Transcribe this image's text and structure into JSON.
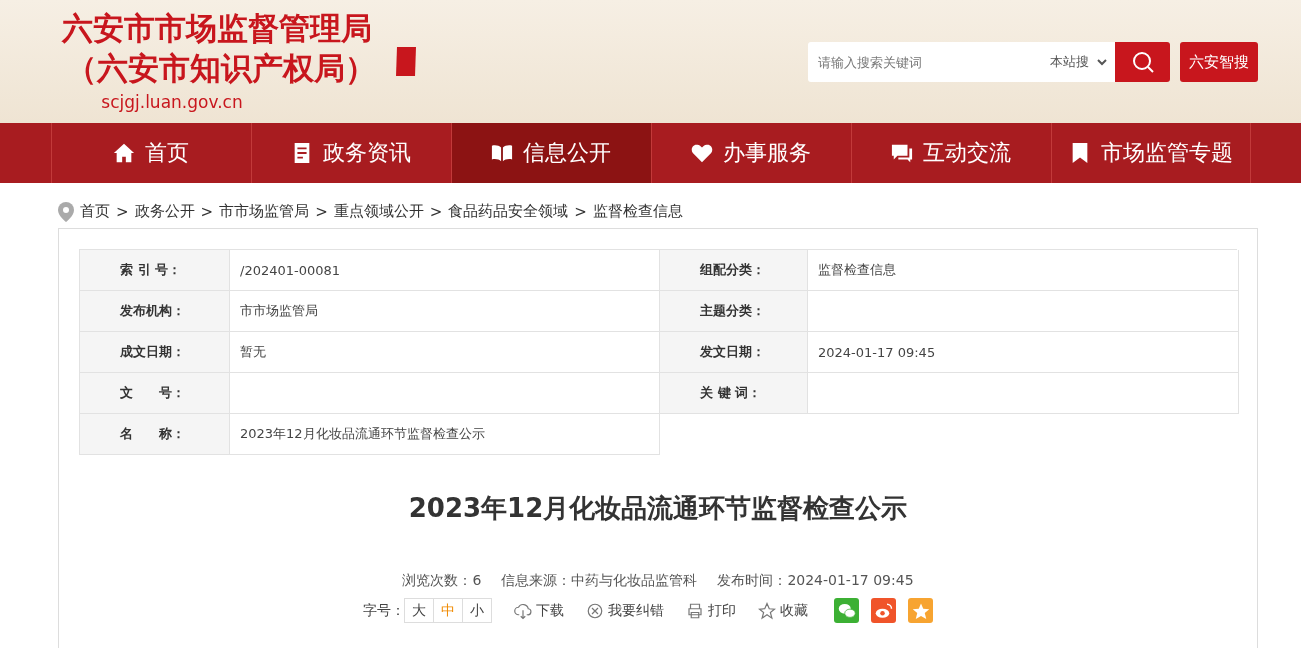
{
  "header": {
    "title_line_1": "六安市市场监督管理局",
    "title_line_2": "（六安市知识产权局）",
    "domain": "scjgj.luan.gov.cn"
  },
  "search": {
    "placeholder": "请输入搜索关键词",
    "scope": "本站搜",
    "smart_search": "六安智搜"
  },
  "nav": [
    {
      "label": "首页",
      "selected": false
    },
    {
      "label": "政务资讯",
      "selected": false
    },
    {
      "label": "信息公开",
      "selected": true
    },
    {
      "label": "办事服务",
      "selected": false
    },
    {
      "label": "互动交流",
      "selected": false
    },
    {
      "label": "市场监管专题",
      "selected": false
    }
  ],
  "breadcrumb": [
    {
      "label": "首页"
    },
    {
      "separator": ">",
      "label": "政务公开"
    },
    {
      "separator": ">",
      "label": "市市场监管局"
    },
    {
      "separator": ">",
      "label": "重点领域公开"
    },
    {
      "separator": ">",
      "label": "食品药品安全领域"
    },
    {
      "separator": ">",
      "label": "监督检查信息"
    }
  ],
  "info_table": [
    [
      {
        "label": "索 引 号：",
        "value": "/202401-00081"
      },
      {
        "label": "组配分类：",
        "value": "监督检查信息"
      }
    ],
    [
      {
        "label": "发布机构：",
        "value": "市市场监管局"
      },
      {
        "label": "主题分类："
      }
    ],
    [
      {
        "label": "成文日期：",
        "value": "暂无"
      },
      {
        "label": "发文日期：",
        "value": "2024-01-17 09:45"
      }
    ],
    [
      {
        "label": "文　　号："
      },
      {
        "label": "关 键 词："
      }
    ],
    [
      {
        "label": "名　　称：",
        "value": "2023年12月化妆品流通环节监督检查公示"
      }
    ]
  ],
  "article": {
    "title": "2023年12月化妆品流通环节监督检查公示",
    "meta": [
      "浏览次数：6",
      "信息来源：中药与化妆品监管科",
      "发布时间：2024-01-17 09:45"
    ],
    "font_size_label": "字号：",
    "font_sizes": [
      {
        "label": "大",
        "selected": false
      },
      {
        "label": "中",
        "selected": true
      },
      {
        "label": "小",
        "selected": false
      }
    ],
    "tools": [
      {
        "label": "下载"
      },
      {
        "label": "我要纠错"
      },
      {
        "label": "打印"
      },
      {
        "label": "收藏"
      }
    ],
    "share": [
      {
        "kind": "wechat",
        "color": "#3cb034"
      },
      {
        "kind": "weibo",
        "color": "#f0542a"
      },
      {
        "kind": "qzone",
        "color": "#f7a431"
      }
    ]
  }
}
